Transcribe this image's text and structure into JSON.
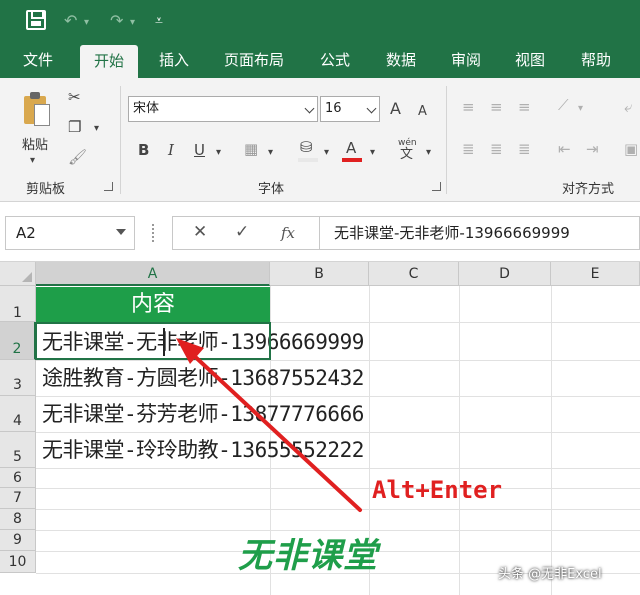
{
  "titlebar": {
    "save_icon": "save-icon",
    "undo_icon": "undo-icon",
    "redo_icon": "redo-icon",
    "qat_customize_icon": "customize-qat-icon",
    "undo_glyph": "↶",
    "redo_glyph": "↷",
    "dropdown_glyph": "▾",
    "customize_glyph": "⩡"
  },
  "tabs": [
    "文件",
    "开始",
    "插入",
    "页面布局",
    "公式",
    "数据",
    "审阅",
    "视图",
    "帮助"
  ],
  "active_tab": "开始",
  "ribbon": {
    "clipboard": {
      "label": "剪贴板",
      "paste_label": "粘贴"
    },
    "font": {
      "label": "字体",
      "font_name": "宋体",
      "font_size": "16",
      "grow_glyph": "A",
      "shrink_glyph": "A",
      "bold": "B",
      "italic": "I",
      "underline": "U",
      "font_color_glyph": "A",
      "phonetic_top": "wén",
      "phonetic_bottom": "文"
    },
    "alignment": {
      "label": "对齐方式"
    }
  },
  "formula_bar": {
    "name_box": "A2",
    "cancel_glyph": "✕",
    "enter_glyph": "✓",
    "fx_glyph": "fx",
    "formula": "无非课堂-无非老师-13966669999"
  },
  "grid": {
    "columns": [
      "A",
      "B",
      "C",
      "D",
      "E"
    ],
    "selected_column": "A",
    "rows": [
      "1",
      "2",
      "3",
      "4",
      "5",
      "6",
      "7",
      "8",
      "9",
      "10"
    ],
    "selected_row": "2",
    "header": "内容",
    "cells": [
      "无非课堂-无非老师-13966669999",
      "途胜教育-方圆老师-13687552432",
      "无非课堂-芬芳老师-13877776666",
      "无非课堂-玲玲助教-13655552222"
    ]
  },
  "annotation": {
    "text": "Alt+Enter",
    "color": "#e02020"
  },
  "brand_text": "无非课堂",
  "watermark": "头条 @无非Excel",
  "colors": {
    "accent": "#217346",
    "header_fill": "#1e9e49",
    "brand": "#1f9e4a"
  }
}
